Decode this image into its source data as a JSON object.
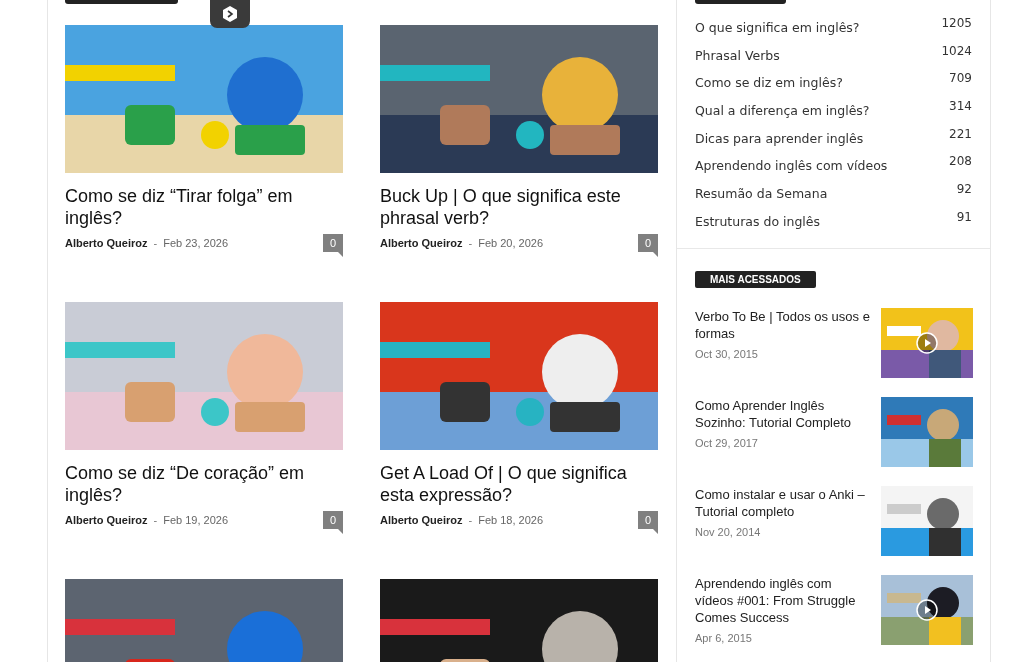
{
  "posts": [
    {
      "kind": "article",
      "title": "Como se diz “Tirar folga” em inglês?",
      "author": "Alberto Queiroz",
      "separator": "-",
      "date": "Feb 23, 2026",
      "comments": "0"
    },
    {
      "kind": "article",
      "title": "Buck Up | O que significa este phrasal verb?",
      "author": "Alberto Queiroz",
      "separator": "-",
      "date": "Feb 20, 2026",
      "comments": "0"
    },
    {
      "kind": "article",
      "title": "Como se diz “De coração” em inglês?",
      "author": "Alberto Queiroz",
      "separator": "-",
      "date": "Feb 19, 2026",
      "comments": "0"
    },
    {
      "kind": "article",
      "title": "Get A Load Of | O que significa esta expressão?",
      "author": "Alberto Queiroz",
      "separator": "-",
      "date": "Feb 18, 2026",
      "comments": "0"
    },
    {
      "kind": "picture"
    },
    {
      "kind": "picture"
    }
  ],
  "categories": [
    {
      "name": "O que significa em inglês?",
      "count": "1205"
    },
    {
      "name": "Phrasal Verbs",
      "count": "1024"
    },
    {
      "name": "Como se diz em inglês?",
      "count": "709"
    },
    {
      "name": "Qual a diferença em inglês?",
      "count": "314"
    },
    {
      "name": "Dicas para aprender inglês",
      "count": "221"
    },
    {
      "name": "Aprendendo inglês com vídeos",
      "count": "208"
    },
    {
      "name": "Resumão da Semana",
      "count": "92"
    },
    {
      "name": "Estruturas do inglês",
      "count": "91"
    }
  ],
  "most_viewed": {
    "title": "MAIS ACESSADOS",
    "items": [
      {
        "title": "Verbo To Be | Todos os usos e formas",
        "date": "Oct 30, 2015",
        "video": true
      },
      {
        "title": "Como Aprender Inglês Sozinho: Tutorial Completo",
        "date": "Oct 29, 2017",
        "video": false
      },
      {
        "title": "Como instalar e usar o Anki – Tutorial completo",
        "date": "Nov 20, 2014",
        "video": false
      },
      {
        "title": "Aprendendo inglês com vídeos #001: From Struggle Comes Success",
        "date": "Apr 6, 2015",
        "video": true
      }
    ]
  }
}
